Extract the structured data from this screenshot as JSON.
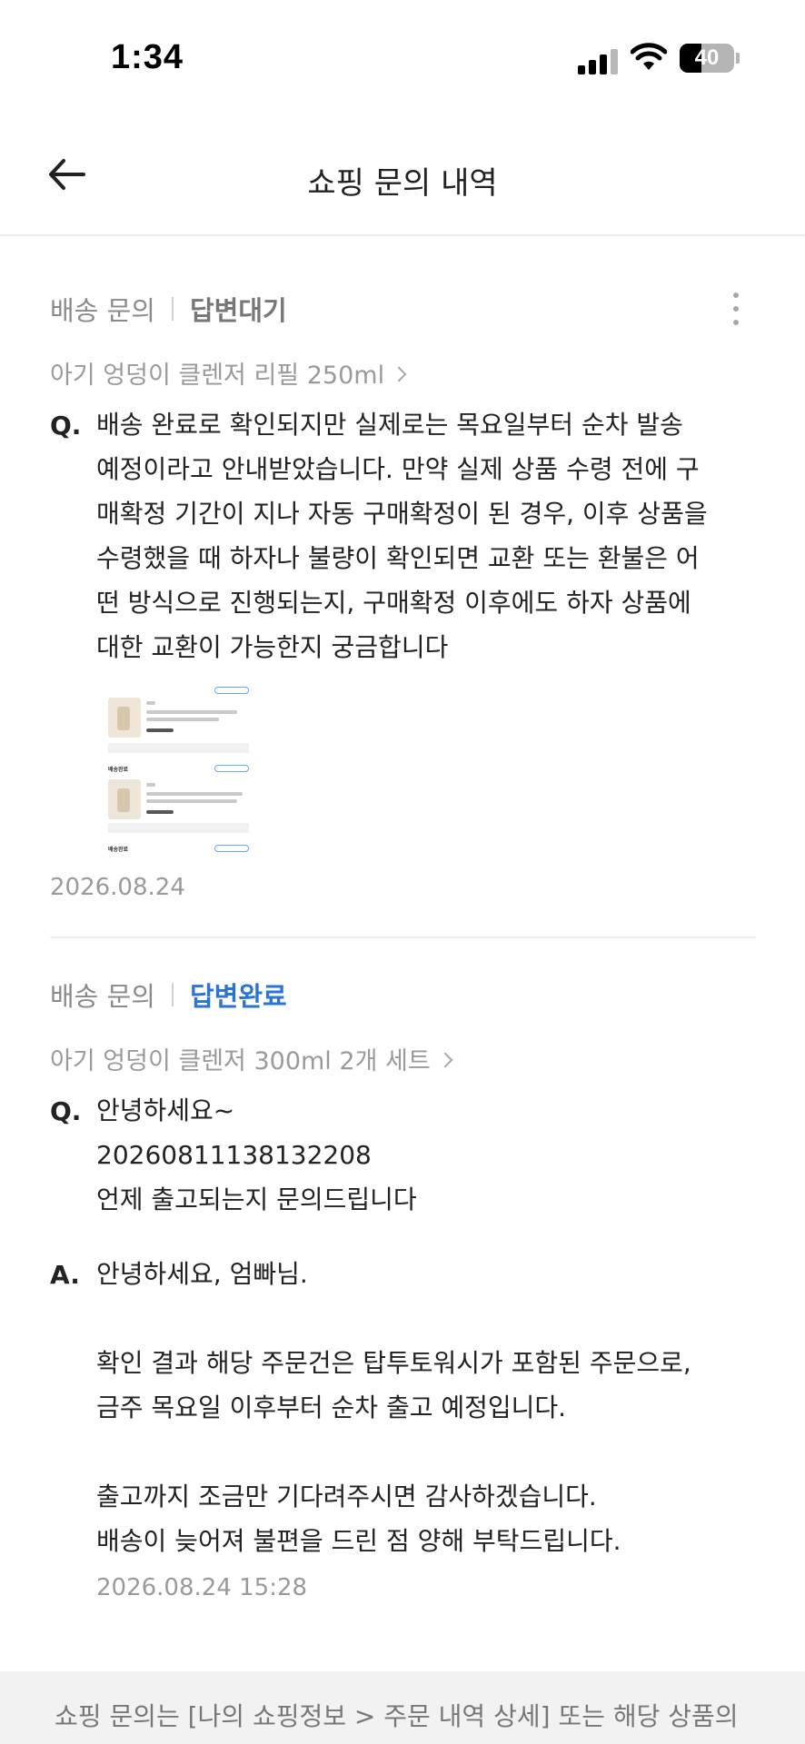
{
  "status_bar": {
    "time": "1:34",
    "battery": "40",
    "battery_level_percent": 40
  },
  "header": {
    "title": "쇼핑 문의 내역",
    "back_icon": "arrow-left-icon"
  },
  "inquiries": [
    {
      "category": "배송 문의",
      "status": "답변대기",
      "product": "아기 엉덩이 클렌저 리필 250ml",
      "question_mark": "Q.",
      "question": "배송 완료로 확인되지만 실제로는 목요일부터 순차 발송\n예정이라고 안내받았습니다. 만약 실제 상품 수령 전에 구\n매확정 기간이 지나 자동 구매확정이 된 경우, 이후 상품을\n수령했을 때 하자나 불량이 확인되면 교환 또는 환불은 어\n떤 방식으로 진행되는지, 구매확정 이후에도 하자 상품에\n대한 교환이 가능한지 궁금합니다",
      "date": "2026.08.24",
      "attachment_labels": [
        "배송완료",
        "배송완료"
      ]
    },
    {
      "category": "배송 문의",
      "status": "답변완료",
      "product": "아기 엉덩이 클렌저 300ml 2개 세트",
      "question_mark": "Q.",
      "question": "안녕하세요~\n20260811138132208\n언제 출고되는지 문의드립니다",
      "answer_mark": "A.",
      "answer": "안녕하세요, 엄빠님.\n\n확인 결과 해당 주문건은 탑투토워시가 포함된 주문으로,\n금주 목요일 이후부터 순차 출고 예정입니다.\n\n출고까지 조금만 기다려주시면 감사하겠습니다.\n배송이 늦어져 불편을 드린 점 양해 부탁드립니다.",
      "answer_date": "2026.08.24 15:28"
    }
  ],
  "footer": {
    "note": "쇼핑 문의는 [나의 쇼핑정보 > 주문 내역 상세] 또는 해당 상품의"
  },
  "colors": {
    "status_done": "#2a74d6",
    "status_pending": "#777777",
    "footer_bg": "#f2f2f2"
  }
}
